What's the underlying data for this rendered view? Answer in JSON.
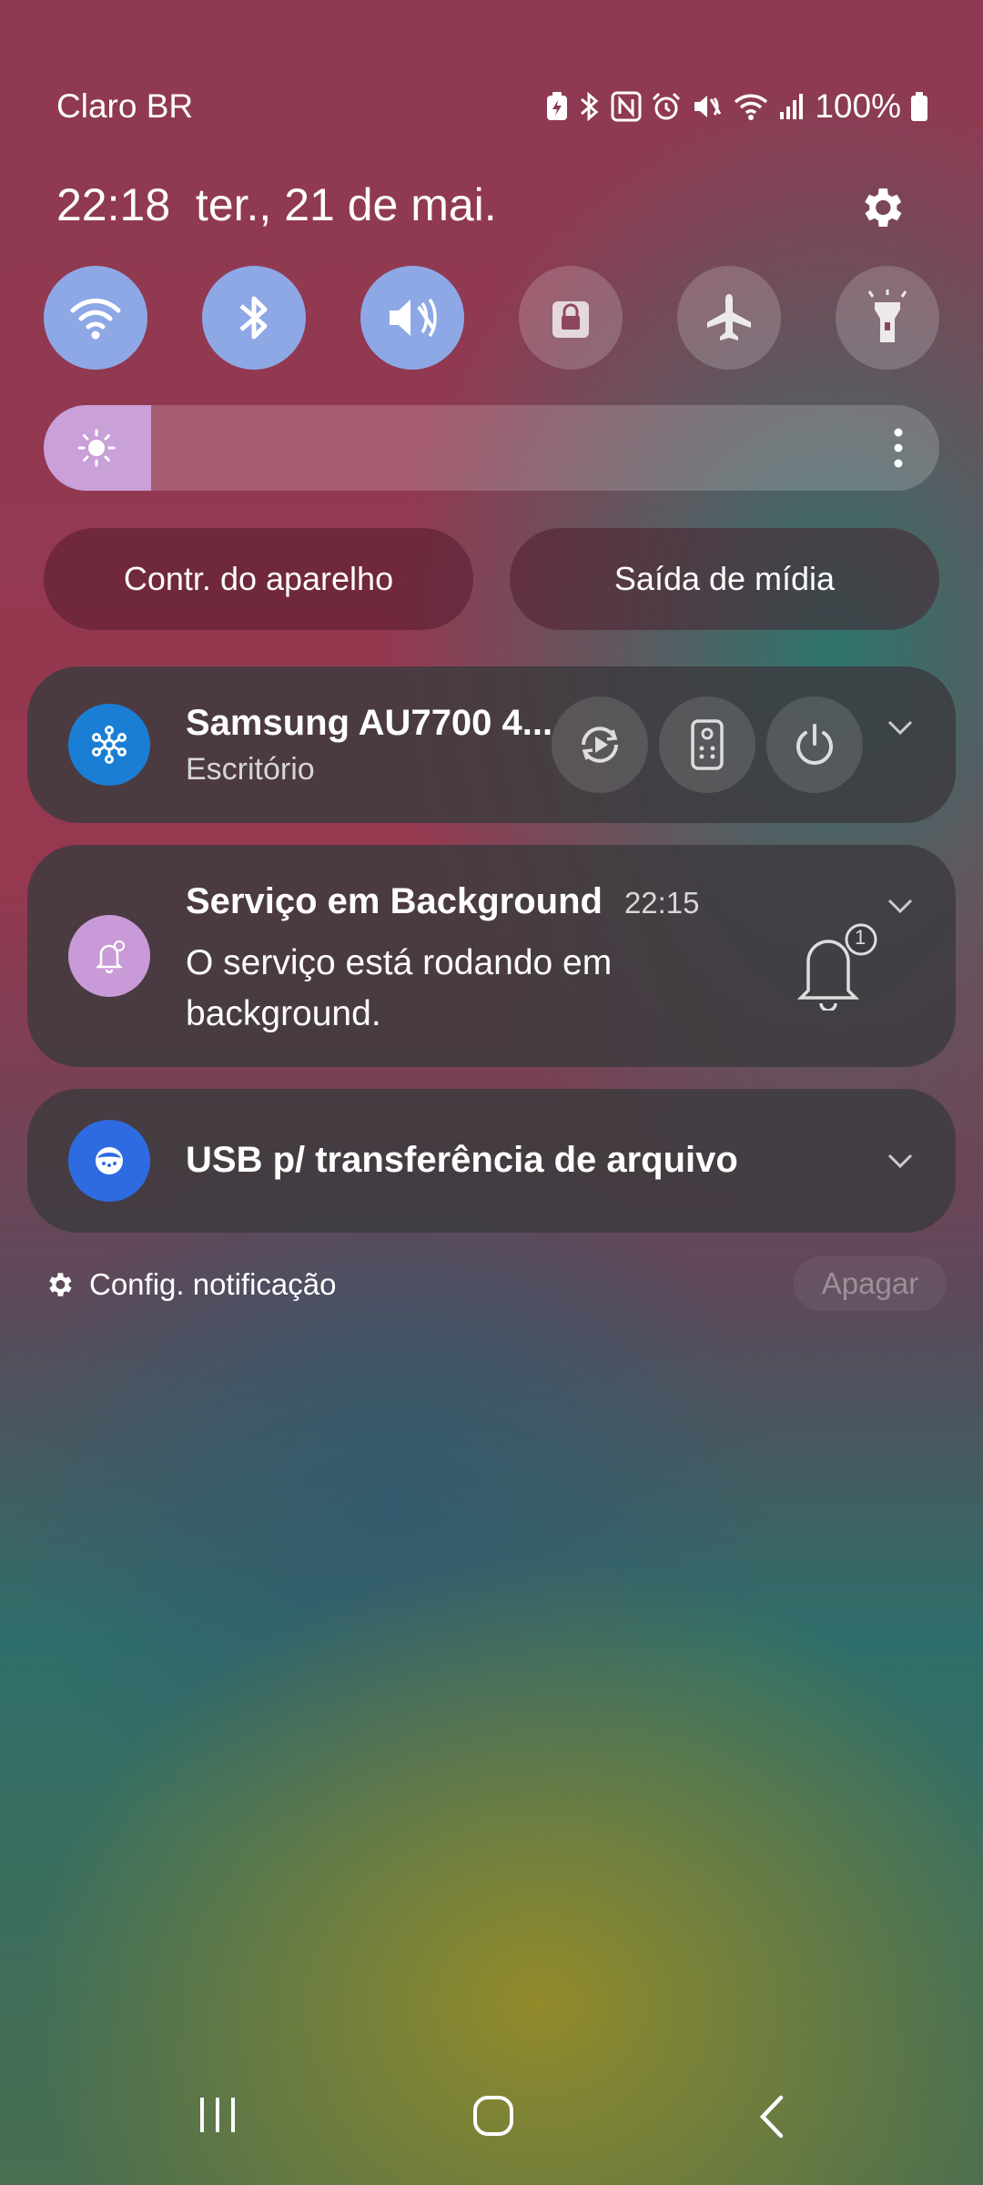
{
  "status_bar": {
    "carrier": "Claro BR",
    "battery_text": "100%",
    "icons": [
      "battery-saver-icon",
      "bluetooth-icon",
      "nfc-icon",
      "alarm-icon",
      "mute-icon",
      "wifi-icon",
      "signal-icon",
      "battery-icon"
    ]
  },
  "header": {
    "time": "22:18",
    "date": "ter., 21 de mai."
  },
  "quick_settings": [
    {
      "name": "wifi",
      "state": "on"
    },
    {
      "name": "bluetooth",
      "state": "on"
    },
    {
      "name": "mute",
      "state": "on"
    },
    {
      "name": "secure-folder",
      "state": "off"
    },
    {
      "name": "airplane-mode",
      "state": "off"
    },
    {
      "name": "flashlight",
      "state": "off"
    }
  ],
  "brightness": {
    "level": 0.12
  },
  "buttons": {
    "device_control": "Contr. do aparelho",
    "media_output": "Saída de mídia"
  },
  "notifications": {
    "smartthings": {
      "title": "Samsung AU7700 4...",
      "subtitle": "Escritório"
    },
    "background_service": {
      "title": "Serviço em Background",
      "time": "22:15",
      "body": "O serviço está rodando em background.",
      "badge": "1"
    },
    "usb": {
      "title": "USB p/ transferência de arquivo"
    }
  },
  "footer": {
    "settings_label": "Config. notificação",
    "clear_label": "Apagar"
  },
  "colors": {
    "qs_on": "#8ea8e6",
    "brightness_fill": "#c9a0d8",
    "smartthings_icon": "#1a7fd4",
    "usb_icon": "#2f6be0",
    "bell_icon": "#c99ad8"
  }
}
